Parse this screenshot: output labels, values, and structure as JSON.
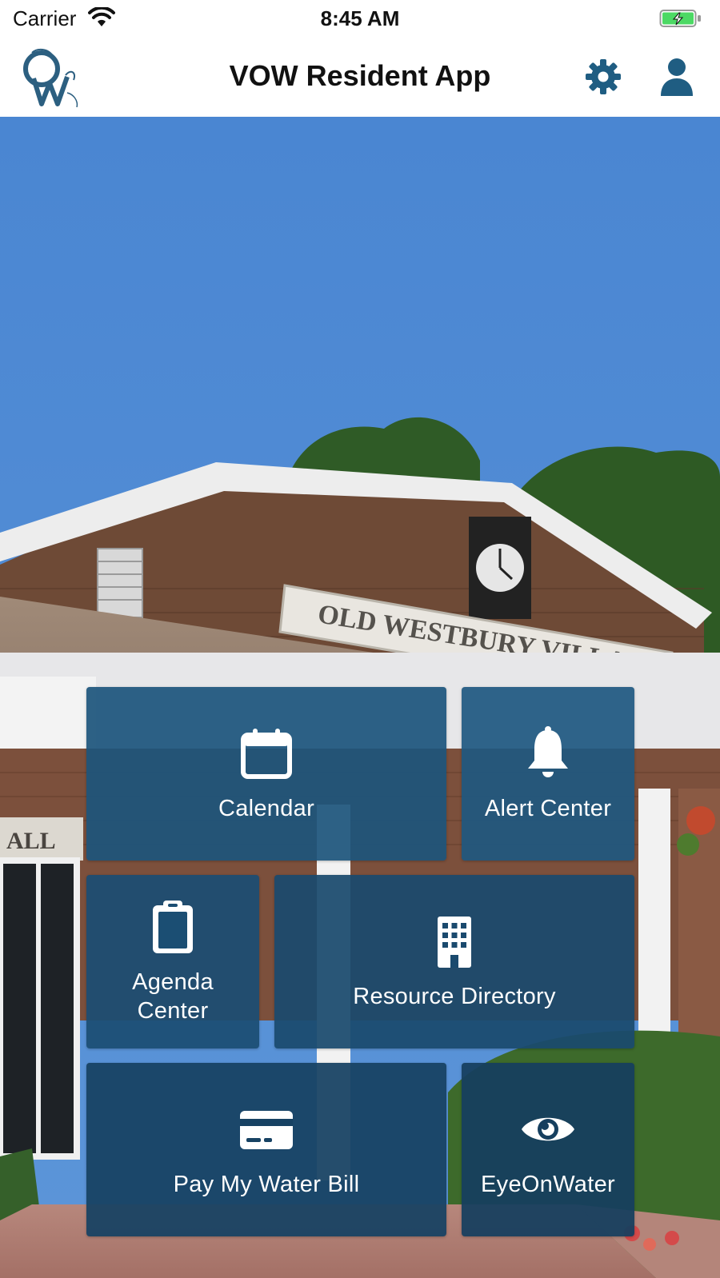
{
  "status_bar": {
    "carrier": "Carrier",
    "time": "8:45 AM",
    "battery_state": "charging"
  },
  "nav": {
    "title": "VOW Resident App",
    "logo_text": "OW",
    "settings_icon": "gear-icon",
    "profile_icon": "user-icon"
  },
  "colors": {
    "accent": "#1F5D82",
    "tile": "#1C557C",
    "sky": "#4A86D2",
    "battery_green": "#4CD964"
  },
  "hero": {
    "sign_text": "OLD WESTBURY VILLAGE HALL",
    "partial_sign_text": "ALL"
  },
  "tiles": [
    {
      "label": "Calendar",
      "icon": "calendar-icon"
    },
    {
      "label": "Alert Center",
      "icon": "bell-icon"
    },
    {
      "label": "Agenda\nCenter",
      "icon": "clipboard-icon"
    },
    {
      "label": "Resource Directory",
      "icon": "building-icon"
    },
    {
      "label": "Pay My Water Bill",
      "icon": "credit-card-icon"
    },
    {
      "label": "EyeOnWater",
      "icon": "eye-icon"
    }
  ]
}
